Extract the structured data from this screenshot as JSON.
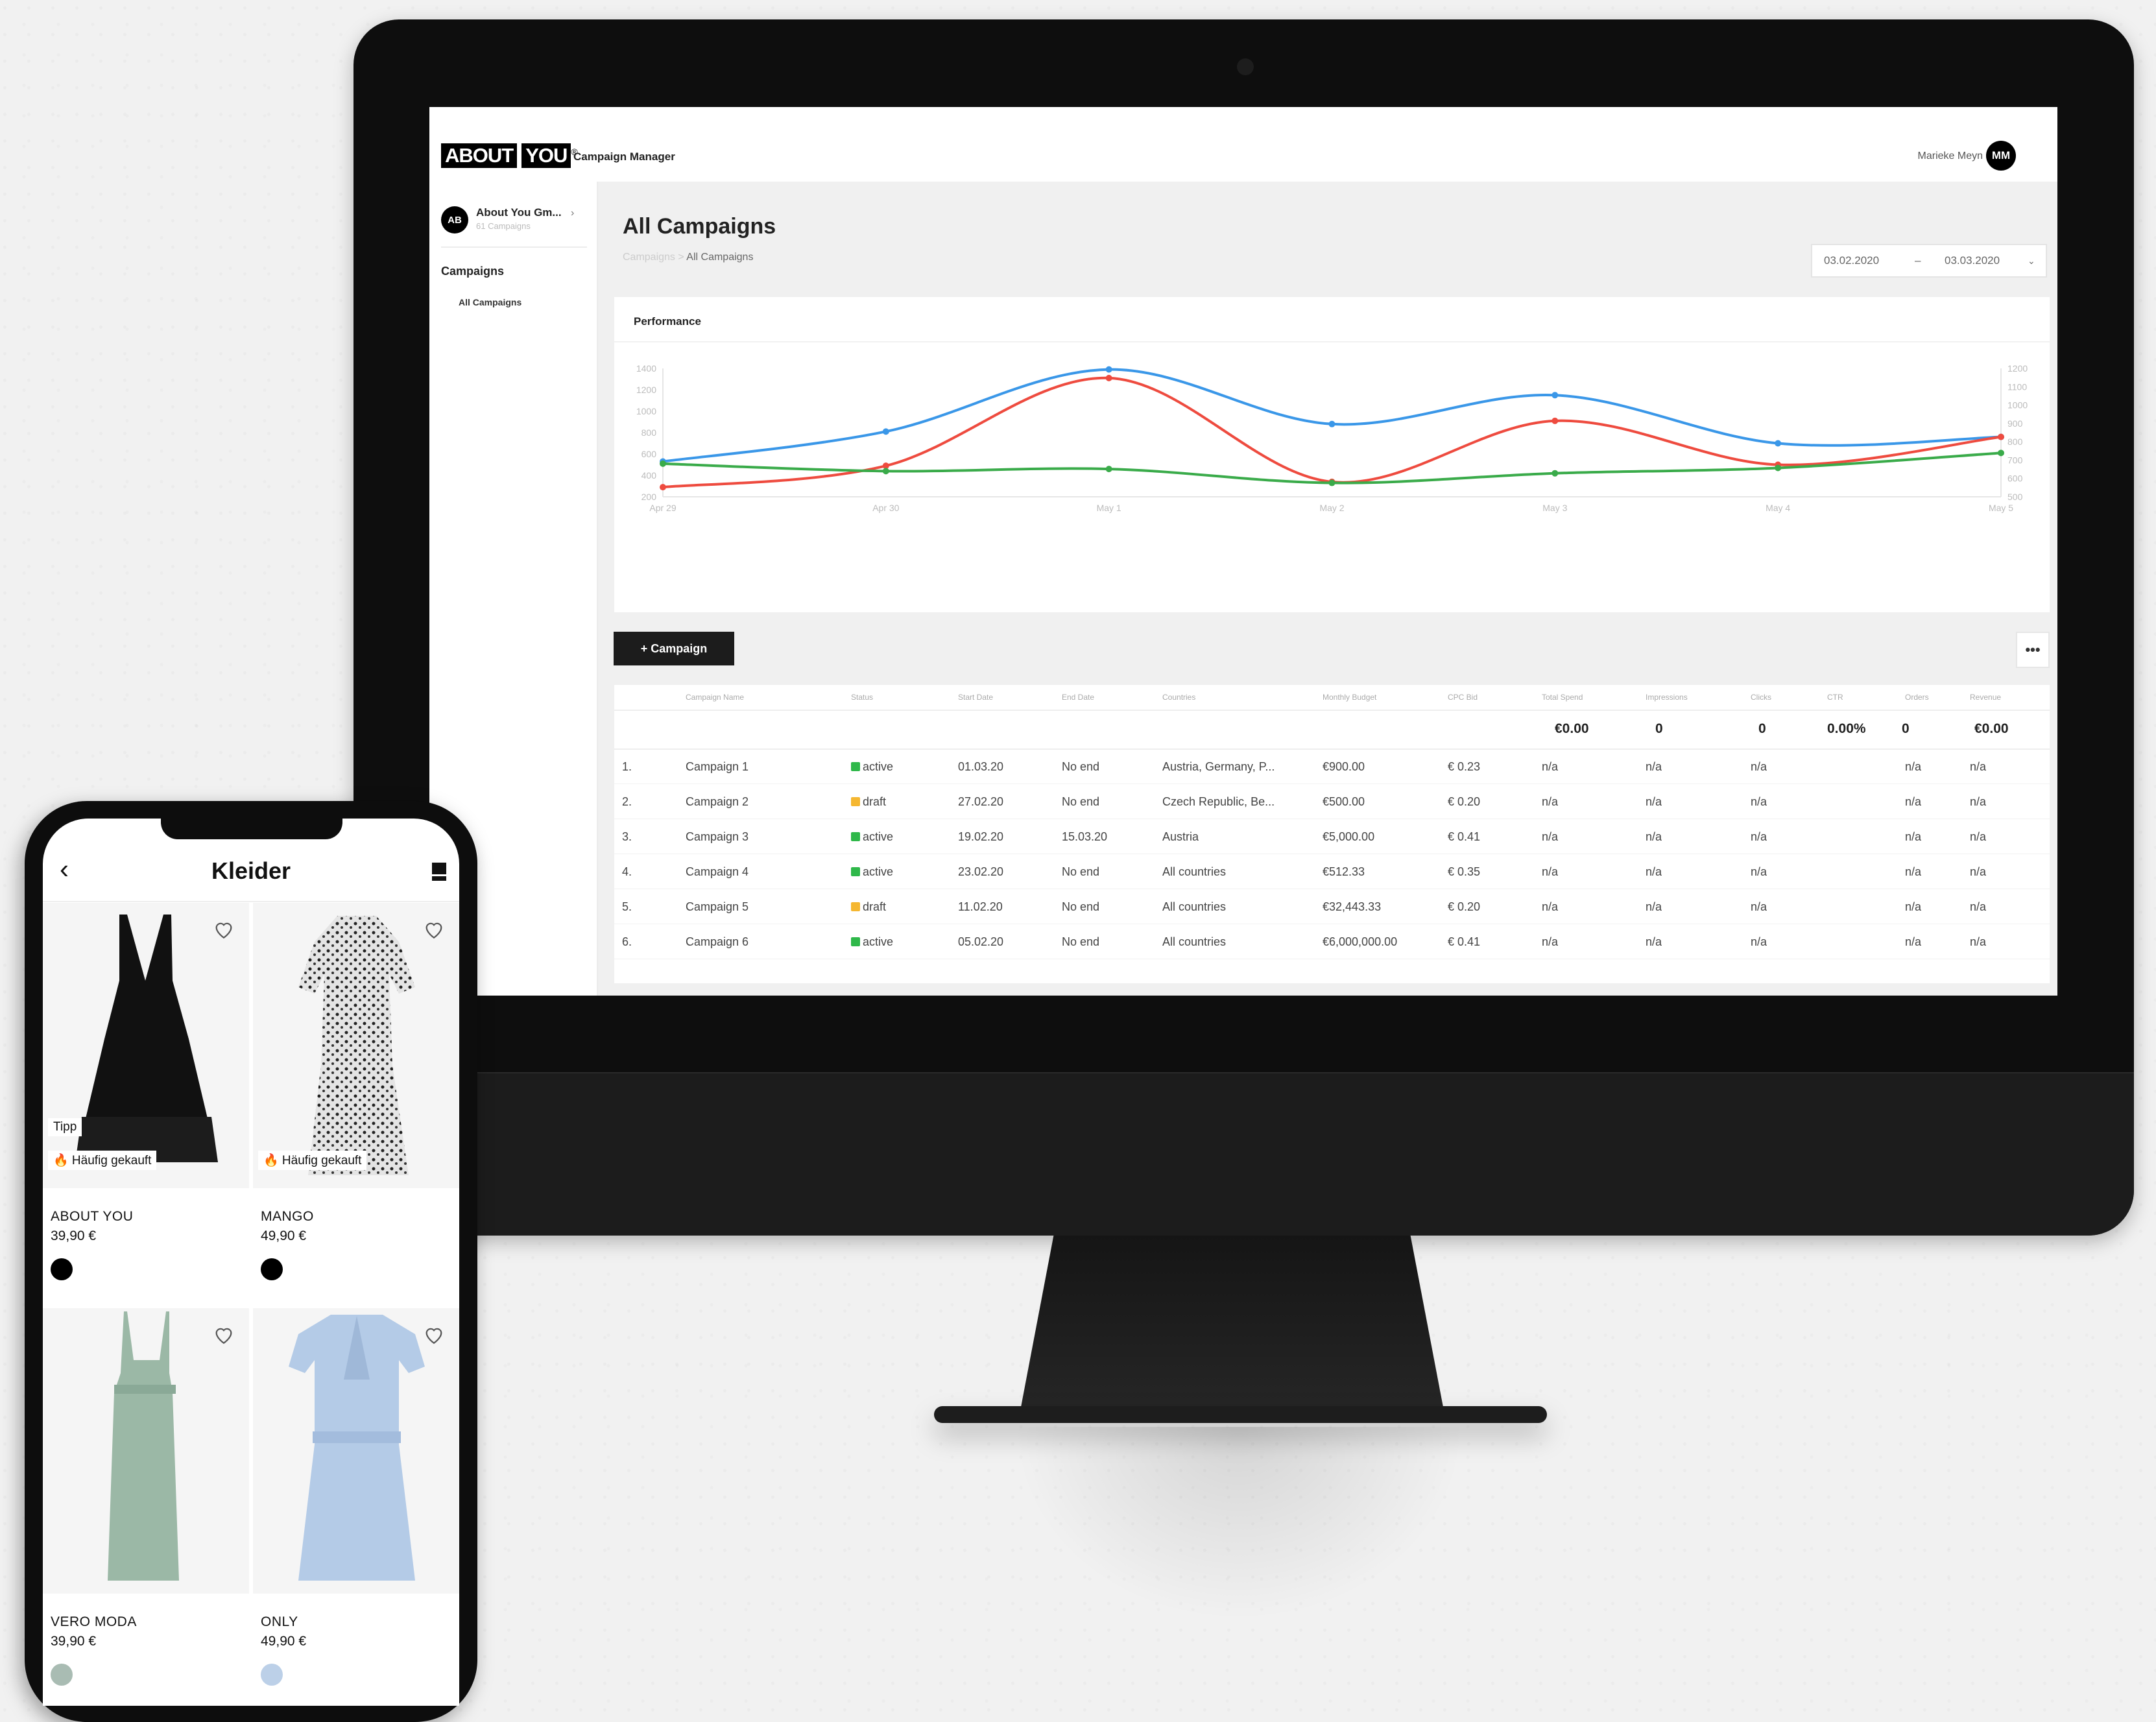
{
  "desktop": {
    "logo": {
      "part1": "ABOUT",
      "part2": "YOU",
      "mark": "®"
    },
    "app_name": "Campaign Manager",
    "user": {
      "name": "Marieke Meyn",
      "initials": "MM"
    },
    "sidebar": {
      "account_initials": "AB",
      "account_name": "About You Gm...",
      "account_sub": "61 Campaigns",
      "section": "Campaigns",
      "items": [
        {
          "label": "All Campaigns"
        }
      ]
    },
    "page_title": "All Campaigns",
    "breadcrumb": {
      "parent": "Campaigns",
      "separator": ">",
      "current": "All Campaigns"
    },
    "date_range": {
      "from": "03.02.2020",
      "separator": "–",
      "to": "03.03.2020",
      "icon": "chevron-down-icon"
    },
    "performance_title": "Performance",
    "add_button": "+ Campaign",
    "more_button": "•••",
    "table": {
      "columns": [
        "Campaign Name",
        "Status",
        "Start Date",
        "End Date",
        "Countries",
        "Monthly Budget",
        "CPC Bid",
        "Total Spend",
        "Impressions",
        "Clicks",
        "CTR",
        "Orders",
        "Revenue"
      ],
      "totals": {
        "total_spend": "€0.00",
        "impressions": "0",
        "clicks": "0",
        "ctr": "0.00%",
        "orders": "0",
        "revenue": "€0.00"
      },
      "rows": [
        {
          "num": "1.",
          "name": "Campaign 1",
          "status": "active",
          "start": "01.03.20",
          "end": "No end",
          "countries": "Austria, Germany, P...",
          "budget": "€900.00",
          "cpc": "€ 0.23",
          "spend": "n/a",
          "impressions": "n/a",
          "clicks": "n/a",
          "ctr": "",
          "orders": "n/a",
          "revenue": "n/a"
        },
        {
          "num": "2.",
          "name": "Campaign 2",
          "status": "draft",
          "start": "27.02.20",
          "end": "No end",
          "countries": "Czech Republic, Be...",
          "budget": "€500.00",
          "cpc": "€ 0.20",
          "spend": "n/a",
          "impressions": "n/a",
          "clicks": "n/a",
          "ctr": "",
          "orders": "n/a",
          "revenue": "n/a"
        },
        {
          "num": "3.",
          "name": "Campaign 3",
          "status": "active",
          "start": "19.02.20",
          "end": "15.03.20",
          "countries": "Austria",
          "budget": "€5,000.00",
          "cpc": "€ 0.41",
          "spend": "n/a",
          "impressions": "n/a",
          "clicks": "n/a",
          "ctr": "",
          "orders": "n/a",
          "revenue": "n/a"
        },
        {
          "num": "4.",
          "name": "Campaign 4",
          "status": "active",
          "start": "23.02.20",
          "end": "No end",
          "countries": "All countries",
          "budget": "€512.33",
          "cpc": "€ 0.35",
          "spend": "n/a",
          "impressions": "n/a",
          "clicks": "n/a",
          "ctr": "",
          "orders": "n/a",
          "revenue": "n/a"
        },
        {
          "num": "5.",
          "name": "Campaign 5",
          "status": "draft",
          "start": "11.02.20",
          "end": "No end",
          "countries": "All countries",
          "budget": "€32,443.33",
          "cpc": "€ 0.20",
          "spend": "n/a",
          "impressions": "n/a",
          "clicks": "n/a",
          "ctr": "",
          "orders": "n/a",
          "revenue": "n/a"
        },
        {
          "num": "6.",
          "name": "Campaign 6",
          "status": "active",
          "start": "05.02.20",
          "end": "No end",
          "countries": "All countries",
          "budget": "€6,000,000.00",
          "cpc": "€ 0.41",
          "spend": "n/a",
          "impressions": "n/a",
          "clicks": "n/a",
          "ctr": "",
          "orders": "n/a",
          "revenue": "n/a"
        }
      ]
    },
    "colors": {
      "active": "#2fb84a",
      "draft": "#f5b731",
      "blue": "#3a97e8",
      "red": "#ee4b3f",
      "green": "#3aab4a"
    }
  },
  "chart_data": {
    "type": "line",
    "title": "Performance",
    "categories": [
      "Apr 29",
      "Apr 30",
      "May 1",
      "May 2",
      "May 3",
      "May 4",
      "May 5"
    ],
    "y_left": {
      "ticks": [
        200,
        400,
        600,
        800,
        1000,
        1200,
        1400
      ],
      "ylim": [
        200,
        1400
      ]
    },
    "y_right": {
      "ticks": [
        500,
        600,
        700,
        800,
        900,
        1000,
        1100,
        1200
      ],
      "ylim": [
        500,
        1200
      ]
    },
    "series": [
      {
        "color": "#3a97e8",
        "axis": "left",
        "values": [
          530,
          810,
          1390,
          880,
          1150,
          700,
          760
        ]
      },
      {
        "color": "#ee4b3f",
        "axis": "left",
        "values": [
          290,
          490,
          1310,
          340,
          910,
          500,
          760
        ]
      },
      {
        "color": "#3aab4a",
        "axis": "left",
        "values": [
          510,
          440,
          460,
          330,
          420,
          470,
          610
        ]
      }
    ],
    "grid": false
  },
  "mobile": {
    "title": "Kleider",
    "back_icon": "chevron-left-icon",
    "bag_icon": "shopping-bag-icon",
    "products": [
      {
        "brand": "ABOUT YOU",
        "price": "39,90 €",
        "badges": [
          "Tipp",
          "🔥 Häufig gekauft"
        ],
        "swatch": "#000000",
        "image": "black-dress"
      },
      {
        "brand": "MANGO",
        "price": "49,90 €",
        "badges": [
          "🔥 Häufig gekauft"
        ],
        "swatch": "#000000",
        "image": "leopard-print-dress"
      },
      {
        "brand": "VERO MODA",
        "price": "39,90 €",
        "badges": [],
        "swatch": "#a9bcb3",
        "image": "mint-dress"
      },
      {
        "brand": "ONLY",
        "price": "49,90 €",
        "badges": [],
        "swatch": "#bcd0e8",
        "image": "light-blue-dress"
      }
    ]
  }
}
